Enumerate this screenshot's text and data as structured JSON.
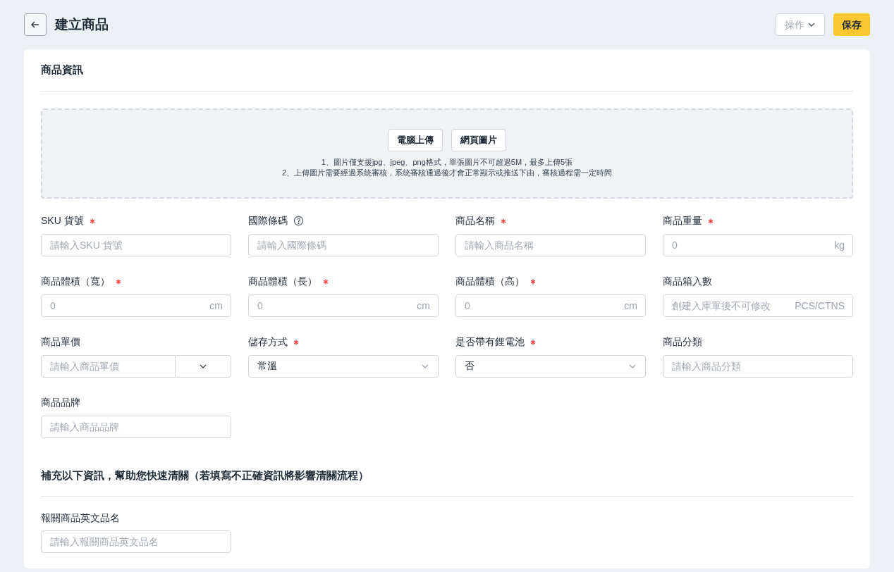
{
  "header": {
    "title": "建立商品",
    "actions_button": "操作",
    "save_button": "保存"
  },
  "section": {
    "title": "商品資訊"
  },
  "upload": {
    "buttons": [
      "電腦上傳",
      "網頁圖片"
    ],
    "notes": [
      "1、圖片僅支援jpg、jpeg、png格式，單張圖片不可超過5M，最多上傳5張",
      "2、上傳圖片需要經過系統審核，系統審核通過後才會正常顯示或推送下由，審核過程需一定時間"
    ]
  },
  "fields": [
    {
      "kind": "text",
      "label": "SKU 貨號",
      "required": true,
      "help": false,
      "placeholder": "請輸入SKU 貨號"
    },
    {
      "kind": "text",
      "label": "國際條碼",
      "required": false,
      "help": true,
      "placeholder": "請輸入國際條碼"
    },
    {
      "kind": "text",
      "label": "商品名稱",
      "required": true,
      "help": false,
      "placeholder": "請輸入商品名稱"
    },
    {
      "kind": "suffix",
      "label": "商品重量",
      "required": true,
      "help": false,
      "placeholder": "0",
      "suffix": "kg"
    },
    {
      "kind": "suffix",
      "label": "商品體積（寬）",
      "required": true,
      "help": false,
      "placeholder": "0",
      "suffix": "cm"
    },
    {
      "kind": "suffix",
      "label": "商品體積（長）",
      "required": true,
      "help": false,
      "placeholder": "0",
      "suffix": "cm"
    },
    {
      "kind": "suffix",
      "label": "商品體積（高）",
      "required": true,
      "help": false,
      "placeholder": "0",
      "suffix": "cm"
    },
    {
      "kind": "suffix",
      "label": "商品箱入數",
      "required": false,
      "help": false,
      "placeholder": "創建入庫單後不可修改",
      "suffix": "PCS/CTNS"
    },
    {
      "kind": "currency",
      "label": "商品單價",
      "required": false,
      "help": false,
      "placeholder": "請輸入商品單價"
    },
    {
      "kind": "select",
      "label": "儲存方式",
      "required": true,
      "help": false,
      "value": "常溫"
    },
    {
      "kind": "select",
      "label": "是否帶有鋰電池",
      "required": true,
      "help": false,
      "value": "否"
    },
    {
      "kind": "text",
      "label": "商品分類",
      "required": false,
      "help": false,
      "placeholder": "請輸入商品分類"
    },
    {
      "kind": "text",
      "label": "商品品牌",
      "required": false,
      "help": false,
      "placeholder": "請輸入商品品牌"
    }
  ],
  "customs": {
    "title": "補充以下資訊，幫助您快速清關（若填寫不正確資訊將影響清關流程）",
    "fields": [
      {
        "kind": "text",
        "label": "報關商品英文品名",
        "required": false,
        "help": false,
        "placeholder": "請輸入報關商品英文品名"
      }
    ]
  }
}
